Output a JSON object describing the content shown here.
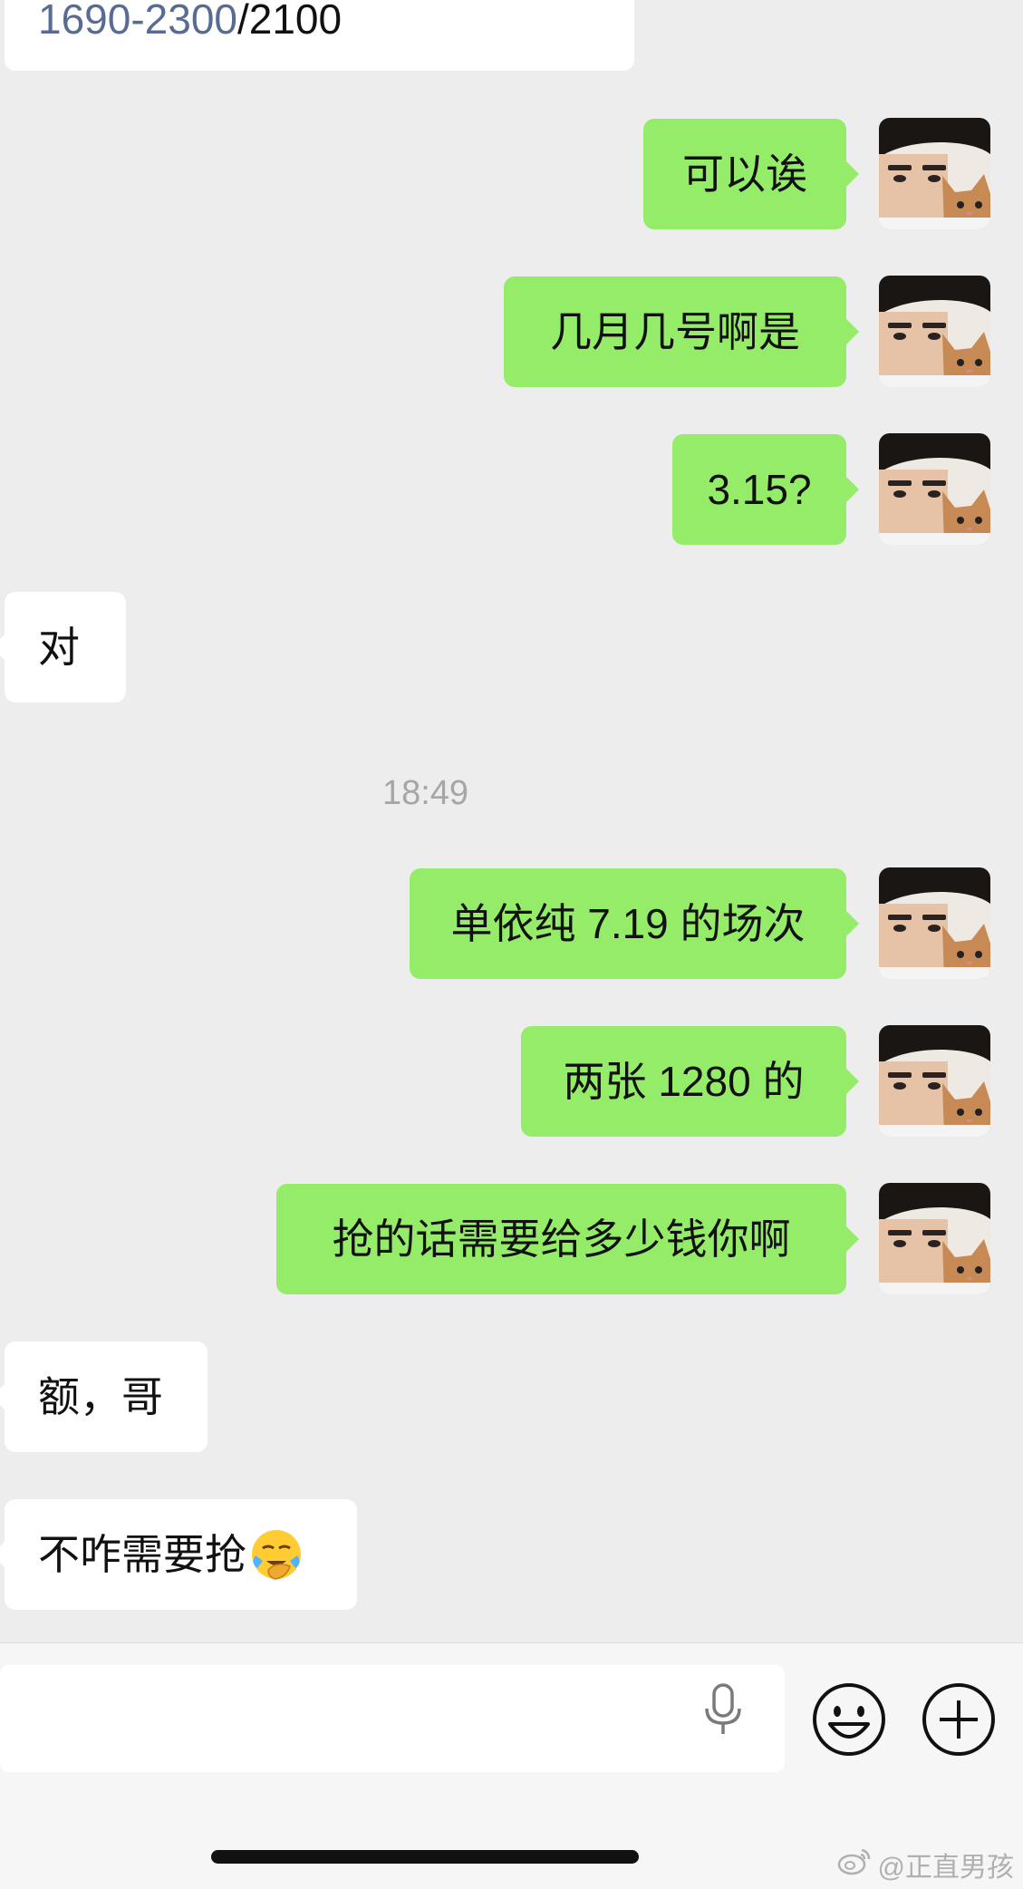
{
  "messages": [
    {
      "id": "m1",
      "dir": "out",
      "text": "可以诶"
    },
    {
      "id": "m2",
      "dir": "out",
      "text": "几月几号啊是"
    },
    {
      "id": "m3",
      "dir": "out",
      "text": "3.15?"
    },
    {
      "id": "m4",
      "dir": "in",
      "text": "对"
    },
    {
      "id": "m5",
      "dir": "out",
      "text": "单依纯 7.19 的场次"
    },
    {
      "id": "m6",
      "dir": "out",
      "text": "两张 1280 的"
    },
    {
      "id": "m7",
      "dir": "out",
      "text": "抢的话需要给多少钱你啊"
    },
    {
      "id": "m8",
      "dir": "in",
      "text": "额，哥"
    },
    {
      "id": "m9",
      "dir": "in",
      "text": "不咋需要抢",
      "emoji": "facepalm-emoji"
    }
  ],
  "top_partial": {
    "link": "1690-2300",
    "rest": "/2100"
  },
  "timestamp": "18:49",
  "watermark": "@正直男孩",
  "icons": {
    "input": [
      "mic-icon",
      "emoji-button-icon",
      "plus-icon"
    ],
    "watermark": "weibo-icon"
  },
  "colors": {
    "outgoing_bubble": "#95ec69",
    "incoming_bubble": "#ffffff",
    "chat_background": "#ededed",
    "link": "#576b95"
  }
}
